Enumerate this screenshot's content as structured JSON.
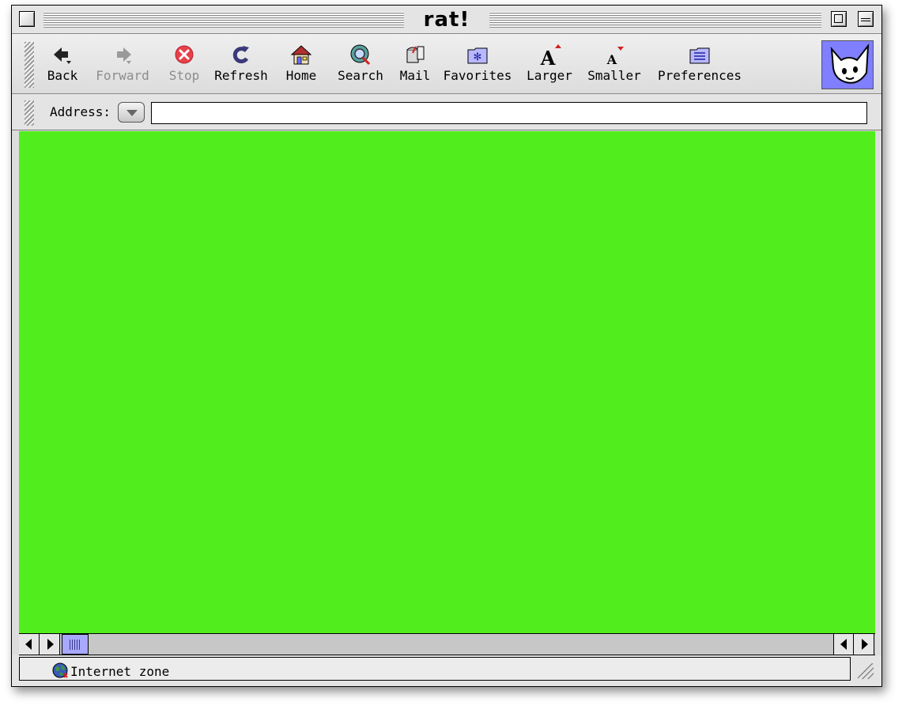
{
  "window": {
    "title": "rat!"
  },
  "toolbar": {
    "buttons": [
      {
        "label": "Back",
        "icon": "back-arrow-icon",
        "enabled": true
      },
      {
        "label": "Forward",
        "icon": "forward-arrow-icon",
        "enabled": false
      },
      {
        "label": "Stop",
        "icon": "stop-icon",
        "enabled": false
      },
      {
        "label": "Refresh",
        "icon": "refresh-icon",
        "enabled": true
      },
      {
        "label": "Home",
        "icon": "home-icon",
        "enabled": true
      },
      {
        "label": "Search",
        "icon": "search-icon",
        "enabled": true
      },
      {
        "label": "Mail",
        "icon": "mail-icon",
        "enabled": true
      },
      {
        "label": "Favorites",
        "icon": "favorites-folder-icon",
        "enabled": true
      },
      {
        "label": "Larger",
        "icon": "font-larger-icon",
        "enabled": true
      },
      {
        "label": "Smaller",
        "icon": "font-smaller-icon",
        "enabled": true
      },
      {
        "label": "Preferences",
        "icon": "preferences-folder-icon",
        "enabled": true
      }
    ],
    "mascot_icon": "cat-mascot-icon"
  },
  "address": {
    "label": "Address:",
    "value": "",
    "placeholder": ""
  },
  "content": {
    "background": "#52ed1d"
  },
  "status": {
    "text": "Internet zone",
    "icon": "globe-icon"
  },
  "colors": {
    "content_green": "#52ed1d",
    "scroll_thumb": "#a8a8ff",
    "mascot_bg": "#7f7fff",
    "stop_red": "#e8404a"
  }
}
